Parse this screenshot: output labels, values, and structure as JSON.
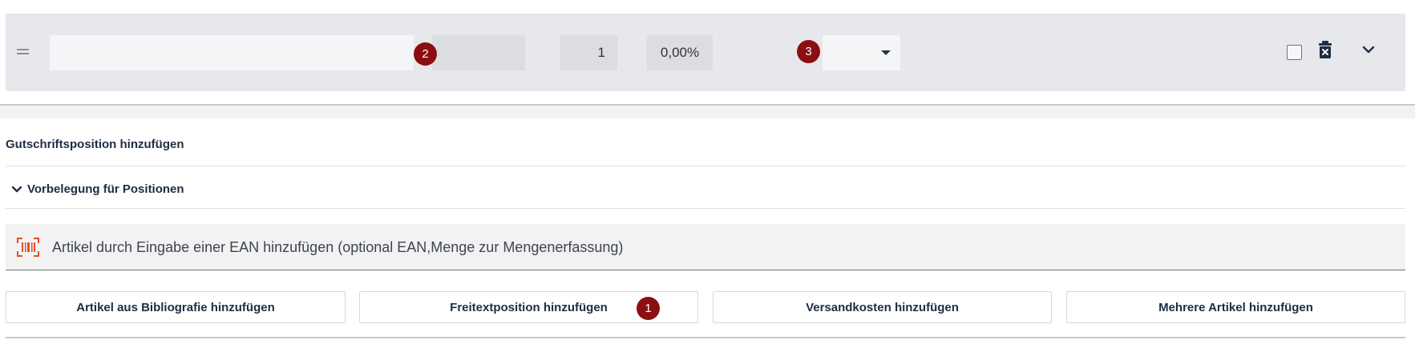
{
  "position_row": {
    "description_value": "",
    "quantity": "1",
    "discount": "0,00%",
    "select_value": ""
  },
  "badges": {
    "b1": "1",
    "b2": "2",
    "b3": "3"
  },
  "sections": {
    "credit_position": "Gutschriftsposition hinzufügen",
    "presets": "Vorbelegung für Positionen"
  },
  "ean": {
    "placeholder": "Artikel durch Eingabe einer EAN hinzufügen (optional EAN,Menge zur Mengenerfassung)"
  },
  "actions": {
    "bibliography": "Artikel aus Bibliografie hinzufügen",
    "freetext": "Freitextposition hinzufügen",
    "shipping": "Versandkosten hinzufügen",
    "multiple": "Mehrere Artikel hinzufügen"
  },
  "icons": {
    "drag": "drag-handle-icon",
    "trash": "trash-icon",
    "expand": "chevron-down-icon",
    "presets": "chevron-down-icon",
    "barcode": "barcode-icon"
  },
  "colors": {
    "badge": "#8b0f10",
    "barcode_accent": "#e0502b",
    "text_dark": "#1e2d42"
  }
}
